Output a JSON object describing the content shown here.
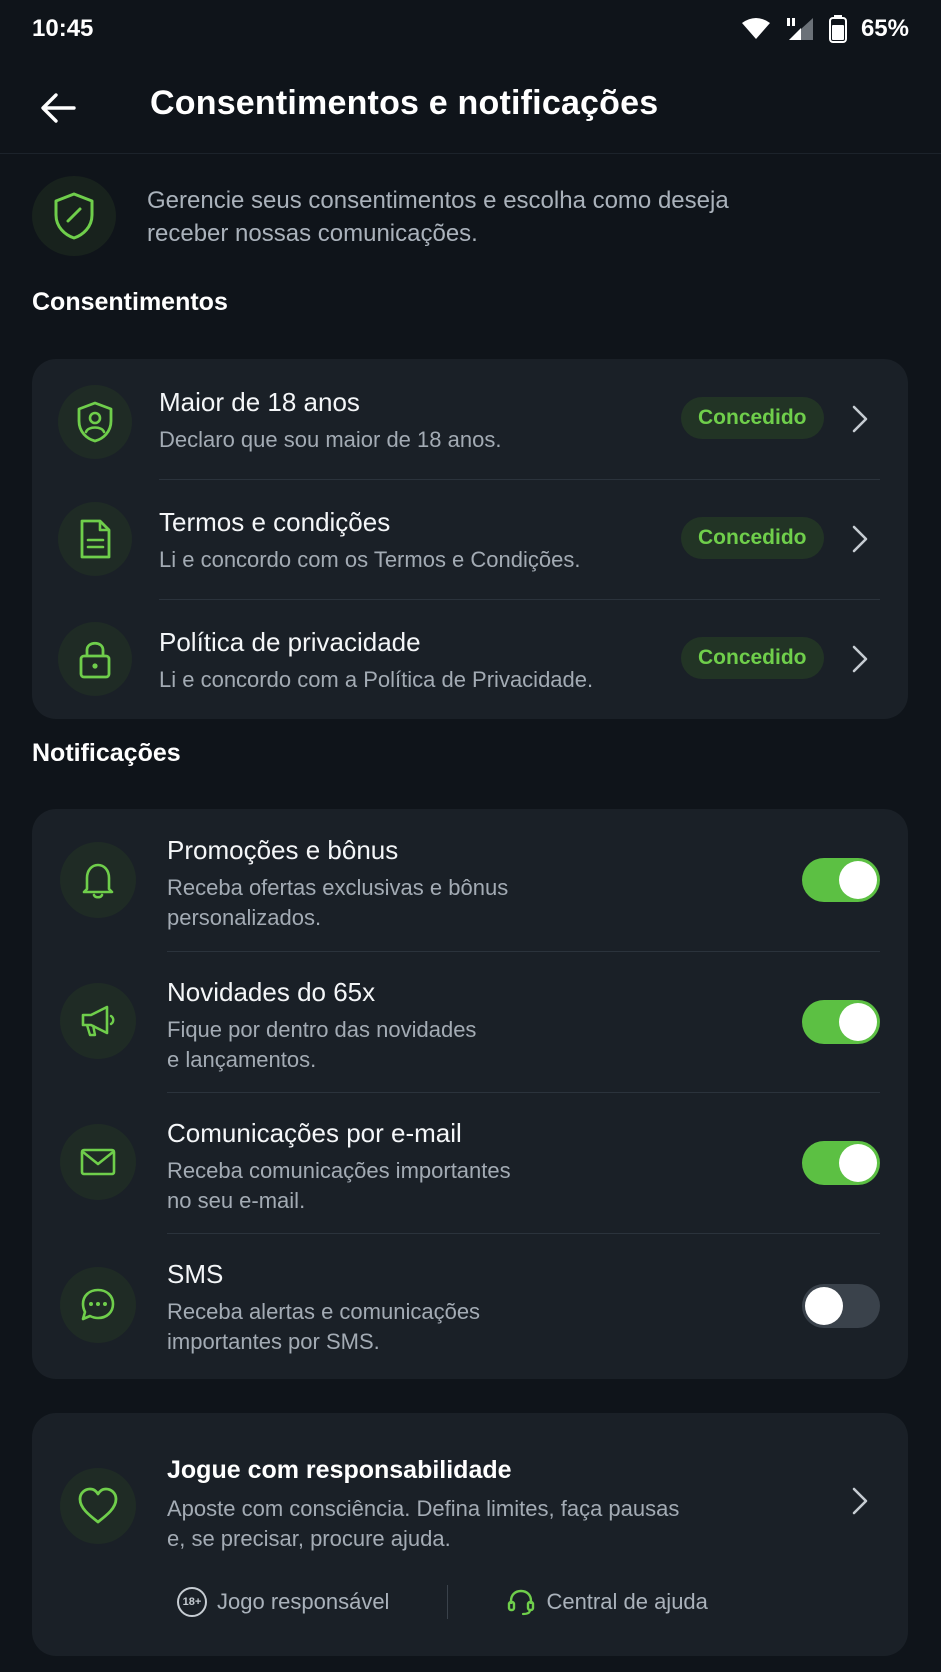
{
  "status_bar": {
    "time": "10:45",
    "battery": "65%"
  },
  "header": {
    "title": "Consentimentos e notificações"
  },
  "intro": {
    "text": "Gerencie seus consentimentos e escolha como deseja receber nossas comunicações."
  },
  "consents": {
    "title": "Consentimentos",
    "items": [
      {
        "title": "Maior de 18 anos",
        "subtitle": "Declaro que sou maior de 18 anos.",
        "status": "Concedido"
      },
      {
        "title": "Termos e condições",
        "subtitle": "Li e concordo com os Termos e Condições.",
        "status": "Concedido"
      },
      {
        "title": "Política de privacidade",
        "subtitle": "Li e concordo com a Política de Privacidade.",
        "status": "Concedido"
      }
    ]
  },
  "notifications": {
    "title": "Notificações",
    "items": [
      {
        "title": "Promoções e bônus",
        "line1": "Receba ofertas exclusivas e bônus",
        "line2": "personalizados.",
        "enabled": true
      },
      {
        "title": "Novidades do 65x",
        "line1": "Fique por dentro das novidades",
        "line2": "e lançamentos.",
        "enabled": true
      },
      {
        "title": "Comunicações por e-mail",
        "line1": "Receba comunicações importantes",
        "line2": "no seu e-mail.",
        "enabled": true
      },
      {
        "title": "SMS",
        "line1": "Receba alertas e comunicações",
        "line2": "importantes por SMS.",
        "enabled": false
      }
    ]
  },
  "responsible": {
    "title": "Jogue com responsabilidade",
    "line1": "Aposte com consciência. Defina limites, faça pausas",
    "line2": "e, se precisar, procure ajuda.",
    "badge_18": "18+",
    "link_responsible": "Jogo responsável",
    "link_help": "Central de ajuda"
  },
  "colors": {
    "accent": "#5cc043",
    "background": "#0f141a",
    "card": "#1a2027"
  }
}
